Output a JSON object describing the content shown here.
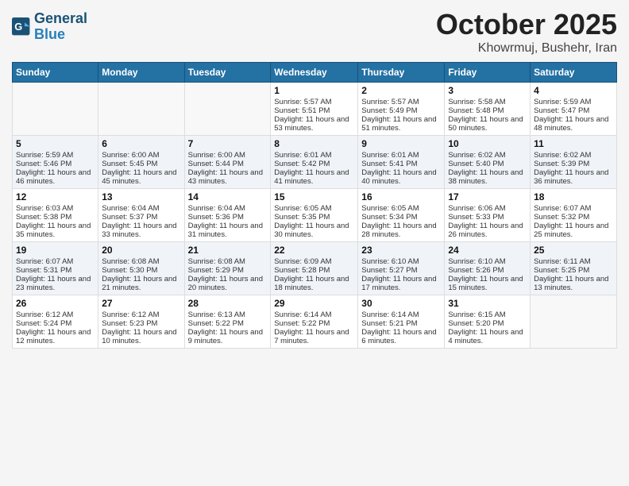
{
  "logo": {
    "line1": "General",
    "line2": "Blue"
  },
  "title": "October 2025",
  "location": "Khowrmuj, Bushehr, Iran",
  "weekdays": [
    "Sunday",
    "Monday",
    "Tuesday",
    "Wednesday",
    "Thursday",
    "Friday",
    "Saturday"
  ],
  "weeks": [
    [
      {
        "day": "",
        "text": ""
      },
      {
        "day": "",
        "text": ""
      },
      {
        "day": "",
        "text": ""
      },
      {
        "day": "1",
        "text": "Sunrise: 5:57 AM\nSunset: 5:51 PM\nDaylight: 11 hours and 53 minutes."
      },
      {
        "day": "2",
        "text": "Sunrise: 5:57 AM\nSunset: 5:49 PM\nDaylight: 11 hours and 51 minutes."
      },
      {
        "day": "3",
        "text": "Sunrise: 5:58 AM\nSunset: 5:48 PM\nDaylight: 11 hours and 50 minutes."
      },
      {
        "day": "4",
        "text": "Sunrise: 5:59 AM\nSunset: 5:47 PM\nDaylight: 11 hours and 48 minutes."
      }
    ],
    [
      {
        "day": "5",
        "text": "Sunrise: 5:59 AM\nSunset: 5:46 PM\nDaylight: 11 hours and 46 minutes."
      },
      {
        "day": "6",
        "text": "Sunrise: 6:00 AM\nSunset: 5:45 PM\nDaylight: 11 hours and 45 minutes."
      },
      {
        "day": "7",
        "text": "Sunrise: 6:00 AM\nSunset: 5:44 PM\nDaylight: 11 hours and 43 minutes."
      },
      {
        "day": "8",
        "text": "Sunrise: 6:01 AM\nSunset: 5:42 PM\nDaylight: 11 hours and 41 minutes."
      },
      {
        "day": "9",
        "text": "Sunrise: 6:01 AM\nSunset: 5:41 PM\nDaylight: 11 hours and 40 minutes."
      },
      {
        "day": "10",
        "text": "Sunrise: 6:02 AM\nSunset: 5:40 PM\nDaylight: 11 hours and 38 minutes."
      },
      {
        "day": "11",
        "text": "Sunrise: 6:02 AM\nSunset: 5:39 PM\nDaylight: 11 hours and 36 minutes."
      }
    ],
    [
      {
        "day": "12",
        "text": "Sunrise: 6:03 AM\nSunset: 5:38 PM\nDaylight: 11 hours and 35 minutes."
      },
      {
        "day": "13",
        "text": "Sunrise: 6:04 AM\nSunset: 5:37 PM\nDaylight: 11 hours and 33 minutes."
      },
      {
        "day": "14",
        "text": "Sunrise: 6:04 AM\nSunset: 5:36 PM\nDaylight: 11 hours and 31 minutes."
      },
      {
        "day": "15",
        "text": "Sunrise: 6:05 AM\nSunset: 5:35 PM\nDaylight: 11 hours and 30 minutes."
      },
      {
        "day": "16",
        "text": "Sunrise: 6:05 AM\nSunset: 5:34 PM\nDaylight: 11 hours and 28 minutes."
      },
      {
        "day": "17",
        "text": "Sunrise: 6:06 AM\nSunset: 5:33 PM\nDaylight: 11 hours and 26 minutes."
      },
      {
        "day": "18",
        "text": "Sunrise: 6:07 AM\nSunset: 5:32 PM\nDaylight: 11 hours and 25 minutes."
      }
    ],
    [
      {
        "day": "19",
        "text": "Sunrise: 6:07 AM\nSunset: 5:31 PM\nDaylight: 11 hours and 23 minutes."
      },
      {
        "day": "20",
        "text": "Sunrise: 6:08 AM\nSunset: 5:30 PM\nDaylight: 11 hours and 21 minutes."
      },
      {
        "day": "21",
        "text": "Sunrise: 6:08 AM\nSunset: 5:29 PM\nDaylight: 11 hours and 20 minutes."
      },
      {
        "day": "22",
        "text": "Sunrise: 6:09 AM\nSunset: 5:28 PM\nDaylight: 11 hours and 18 minutes."
      },
      {
        "day": "23",
        "text": "Sunrise: 6:10 AM\nSunset: 5:27 PM\nDaylight: 11 hours and 17 minutes."
      },
      {
        "day": "24",
        "text": "Sunrise: 6:10 AM\nSunset: 5:26 PM\nDaylight: 11 hours and 15 minutes."
      },
      {
        "day": "25",
        "text": "Sunrise: 6:11 AM\nSunset: 5:25 PM\nDaylight: 11 hours and 13 minutes."
      }
    ],
    [
      {
        "day": "26",
        "text": "Sunrise: 6:12 AM\nSunset: 5:24 PM\nDaylight: 11 hours and 12 minutes."
      },
      {
        "day": "27",
        "text": "Sunrise: 6:12 AM\nSunset: 5:23 PM\nDaylight: 11 hours and 10 minutes."
      },
      {
        "day": "28",
        "text": "Sunrise: 6:13 AM\nSunset: 5:22 PM\nDaylight: 11 hours and 9 minutes."
      },
      {
        "day": "29",
        "text": "Sunrise: 6:14 AM\nSunset: 5:22 PM\nDaylight: 11 hours and 7 minutes."
      },
      {
        "day": "30",
        "text": "Sunrise: 6:14 AM\nSunset: 5:21 PM\nDaylight: 11 hours and 6 minutes."
      },
      {
        "day": "31",
        "text": "Sunrise: 6:15 AM\nSunset: 5:20 PM\nDaylight: 11 hours and 4 minutes."
      },
      {
        "day": "",
        "text": ""
      }
    ]
  ]
}
